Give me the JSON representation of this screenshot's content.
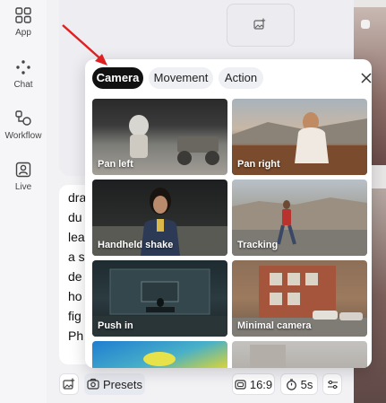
{
  "nav": {
    "items": [
      {
        "label": "App",
        "icon": "grid-icon"
      },
      {
        "label": "Chat",
        "icon": "sparkle-icon"
      },
      {
        "label": "Workflow",
        "icon": "workflow-icon"
      },
      {
        "label": "Live",
        "icon": "person-icon"
      }
    ]
  },
  "prompt": {
    "lines": [
      "dra",
      "du",
      "lea",
      "a s",
      "de",
      "ho",
      "fig",
      "Ph"
    ]
  },
  "toolbar": {
    "presets_label": "Presets",
    "ratio_label": "16:9",
    "duration_label": "5s"
  },
  "presets_popup": {
    "tabs": [
      {
        "label": "Camera",
        "active": true
      },
      {
        "label": "Movement",
        "active": false
      },
      {
        "label": "Action",
        "active": false
      }
    ],
    "presets": [
      {
        "label": "Pan left"
      },
      {
        "label": "Pan right"
      },
      {
        "label": "Handheld shake"
      },
      {
        "label": "Tracking"
      },
      {
        "label": "Push in"
      },
      {
        "label": "Minimal camera"
      },
      {
        "label": ""
      },
      {
        "label": ""
      }
    ]
  },
  "colors": {
    "active_tab_bg": "#111111",
    "annotation_arrow": "#e02020"
  }
}
